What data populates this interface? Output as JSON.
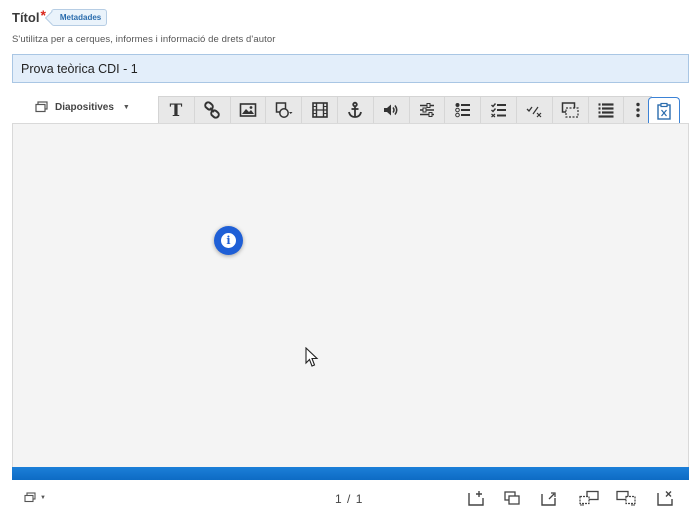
{
  "field": {
    "label": "Títol",
    "required_mark": "*",
    "metadata_tag": "Metadades",
    "hint": "S'utilitza per a cerques, informes i informació de drets d'autor",
    "value": "Prova teòrica CDI - 1"
  },
  "editor": {
    "mode_label": "Diapositives",
    "toolbar_icons": [
      "text-icon",
      "link-icon",
      "image-icon",
      "shapes-icon",
      "video-icon",
      "anchor-icon",
      "audio-icon",
      "slider-icon",
      "single-choice-icon",
      "multi-choice-icon",
      "fill-blanks-icon",
      "drag-drop-icon",
      "list-icon",
      "more-icon",
      "paste-icon"
    ],
    "accent_color": "#1f5fd6",
    "progress_bar_color": "#0d6bc4"
  },
  "footer": {
    "page_current": "1",
    "page_separator": "/",
    "page_total": "1"
  }
}
